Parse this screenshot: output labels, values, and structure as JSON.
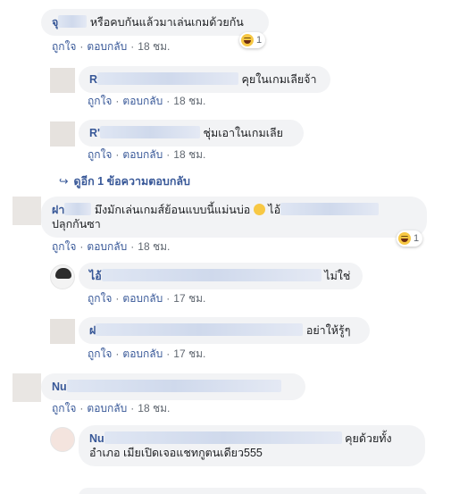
{
  "actions": {
    "like": "ถูกใจ",
    "reply": "ตอบกลับ",
    "separator": "·"
  },
  "comments": [
    {
      "name_initial": "จุ",
      "text": "หรือคบกันแล้วมาเล่นเกมด้วยกัน",
      "time": "18 ชม.",
      "reaction_count": "1"
    },
    {
      "name_initial": "R",
      "text": "คุยในเกมเลียจ้า",
      "time": "18 ชม."
    },
    {
      "name_initial": "R'",
      "text": "ชุ่มเอาในเกมเลีย",
      "time": "18 ชม."
    },
    {
      "name_initial": "ฝา",
      "text_line1": "มึงมักเล่นเกมส์ย้อนแบบนี้แม่นบ่อ",
      "text_mid": "ไอ้",
      "text_line2": "ปลุกกันซา",
      "time": "18 ชม.",
      "reaction_count": "1"
    },
    {
      "name_initial": "ไอ้",
      "text": "ไม่ใช่",
      "time": "17 ชม."
    },
    {
      "name_initial": "ฝ",
      "text": "อย่าให้รู้ๆ",
      "time": "17 ชม."
    },
    {
      "name_initial": "Nu",
      "time": "18 ชม."
    },
    {
      "name_initial": "Nu",
      "text_line1": "คุยด้วยทั้ง",
      "text_line2": "อำเภอ เมียเปิดเจอแชทกูตนเดียว555"
    }
  ],
  "more_replies": "ดูอีก 1 ข้อความตอบกลับ"
}
